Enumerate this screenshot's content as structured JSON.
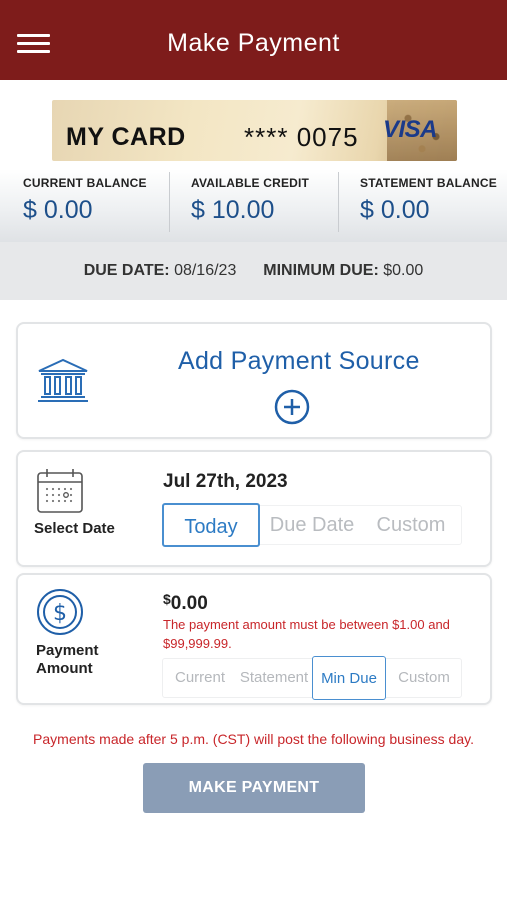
{
  "header": {
    "title": "Make Payment",
    "menu_icon": "hamburger-menu-icon",
    "background_color": "#7e1c1b"
  },
  "card": {
    "name": "MY CARD",
    "number_masked": "**** 0075",
    "brand": "VISA"
  },
  "balances": [
    {
      "label": "CURRENT BALANCE",
      "value": "$ 0.00"
    },
    {
      "label": "AVAILABLE CREDIT",
      "value": "$ 10.00"
    },
    {
      "label": "STATEMENT BALANCE",
      "value": "$ 0.00"
    }
  ],
  "due": {
    "due_date_label": "DUE DATE:",
    "due_date_value": "08/16/23",
    "minimum_due_label": "MINIMUM DUE:",
    "minimum_due_value": "$0.00"
  },
  "payment_source": {
    "title": "Add Payment Source",
    "icon": "bank-icon",
    "add_icon": "plus-circle-icon"
  },
  "date_section": {
    "label": "Select Date",
    "icon": "calendar-icon",
    "selected_date": "Jul 27th, 2023",
    "options": [
      "Today",
      "Due Date",
      "Custom"
    ],
    "selected_option": "Today"
  },
  "amount_section": {
    "label": "Payment Amount",
    "icon": "dollar-circle-icon",
    "currency_symbol": "$",
    "amount": "0.00",
    "error_message": "The payment amount must be between $1.00 and $99,999.99.",
    "options": [
      "Current",
      "Statement",
      "Min Due",
      "Custom"
    ],
    "selected_option": "Min Due"
  },
  "notice": "Payments made after 5 p.m. (CST) will post the following business day.",
  "submit_button": "MAKE PAYMENT",
  "colors": {
    "accent_blue": "#1f5fa8",
    "error_red": "#c8262a",
    "button_disabled": "#8a9db6"
  }
}
